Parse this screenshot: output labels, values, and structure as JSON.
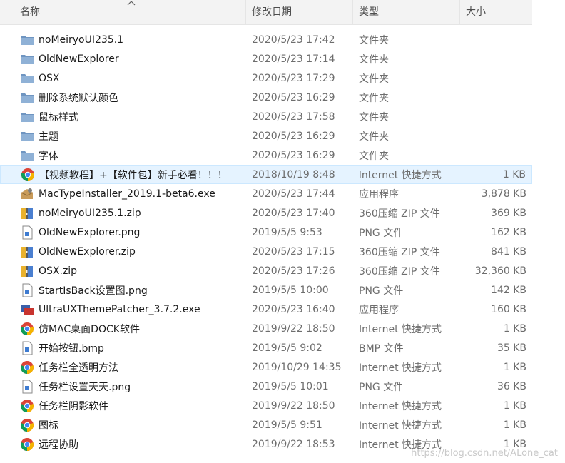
{
  "columns": {
    "name": "名称",
    "date": "修改日期",
    "type": "类型",
    "size": "大小",
    "sort_indicator": "^"
  },
  "colors": {
    "folder": "#8fb1d6",
    "folder_dark": "#6f95c1",
    "chrome_red": "#db4437",
    "chrome_yellow": "#f4b400",
    "chrome_green": "#0f9d58",
    "chrome_blue": "#4285f4",
    "selection": "#e5f3ff"
  },
  "files": [
    {
      "name": "noMeiryoUI235.1",
      "date": "2020/5/23 17:42",
      "type": "文件夹",
      "size": "",
      "icon": "folder-icon"
    },
    {
      "name": "OldNewExplorer",
      "date": "2020/5/23 17:14",
      "type": "文件夹",
      "size": "",
      "icon": "folder-icon"
    },
    {
      "name": "OSX",
      "date": "2020/5/23 17:29",
      "type": "文件夹",
      "size": "",
      "icon": "folder-icon"
    },
    {
      "name": "删除系统默认颜色",
      "date": "2020/5/23 16:29",
      "type": "文件夹",
      "size": "",
      "icon": "folder-icon"
    },
    {
      "name": "鼠标样式",
      "date": "2020/5/23 17:58",
      "type": "文件夹",
      "size": "",
      "icon": "folder-icon"
    },
    {
      "name": "主题",
      "date": "2020/5/23 16:29",
      "type": "文件夹",
      "size": "",
      "icon": "folder-icon"
    },
    {
      "name": "字体",
      "date": "2020/5/23 16:29",
      "type": "文件夹",
      "size": "",
      "icon": "folder-icon"
    },
    {
      "name": "【视频教程】+【软件包】新手必看！！！",
      "date": "2018/10/19 8:48",
      "type": "Internet 快捷方式",
      "size": "1 KB",
      "icon": "chrome-icon"
    },
    {
      "name": "MacTypeInstaller_2019.1-beta6.exe",
      "date": "2020/5/23 17:44",
      "type": "应用程序",
      "size": "3,878 KB",
      "icon": "installer-icon"
    },
    {
      "name": "noMeiryoUI235.1.zip",
      "date": "2020/5/23 17:40",
      "type": "360压缩 ZIP 文件",
      "size": "369 KB",
      "icon": "zip-icon"
    },
    {
      "name": "OldNewExplorer.png",
      "date": "2019/5/5 9:53",
      "type": "PNG 文件",
      "size": "162 KB",
      "icon": "image-file-icon"
    },
    {
      "name": "OldNewExplorer.zip",
      "date": "2020/5/23 17:15",
      "type": "360压缩 ZIP 文件",
      "size": "841 KB",
      "icon": "zip-icon"
    },
    {
      "name": "OSX.zip",
      "date": "2020/5/23 17:26",
      "type": "360压缩 ZIP 文件",
      "size": "32,360 KB",
      "icon": "zip-icon"
    },
    {
      "name": "StartIsBack设置图.png",
      "date": "2019/5/5 10:00",
      "type": "PNG 文件",
      "size": "142 KB",
      "icon": "image-file-icon"
    },
    {
      "name": "UltraUXThemePatcher_3.7.2.exe",
      "date": "2020/5/23 16:40",
      "type": "应用程序",
      "size": "160 KB",
      "icon": "patcher-icon"
    },
    {
      "name": "仿MAC桌面DOCK软件",
      "date": "2019/9/22 18:50",
      "type": "Internet 快捷方式",
      "size": "1 KB",
      "icon": "chrome-icon"
    },
    {
      "name": "开始按钮.bmp",
      "date": "2019/5/5 9:02",
      "type": "BMP 文件",
      "size": "35 KB",
      "icon": "image-file-icon"
    },
    {
      "name": "任务栏全透明方法",
      "date": "2019/10/29 14:35",
      "type": "Internet 快捷方式",
      "size": "1 KB",
      "icon": "chrome-icon"
    },
    {
      "name": "任务栏设置天天.png",
      "date": "2019/5/5 10:01",
      "type": "PNG 文件",
      "size": "36 KB",
      "icon": "image-file-icon"
    },
    {
      "name": "任务栏阴影软件",
      "date": "2019/9/22 18:50",
      "type": "Internet 快捷方式",
      "size": "1 KB",
      "icon": "chrome-icon"
    },
    {
      "name": "图标",
      "date": "2019/5/5 9:51",
      "type": "Internet 快捷方式",
      "size": "1 KB",
      "icon": "chrome-icon"
    },
    {
      "name": "远程协助",
      "date": "2019/9/22 18:53",
      "type": "Internet 快捷方式",
      "size": "1 KB",
      "icon": "chrome-icon"
    }
  ],
  "selected_index": 7,
  "watermark": "https://blog.csdn.net/ALone_cat"
}
